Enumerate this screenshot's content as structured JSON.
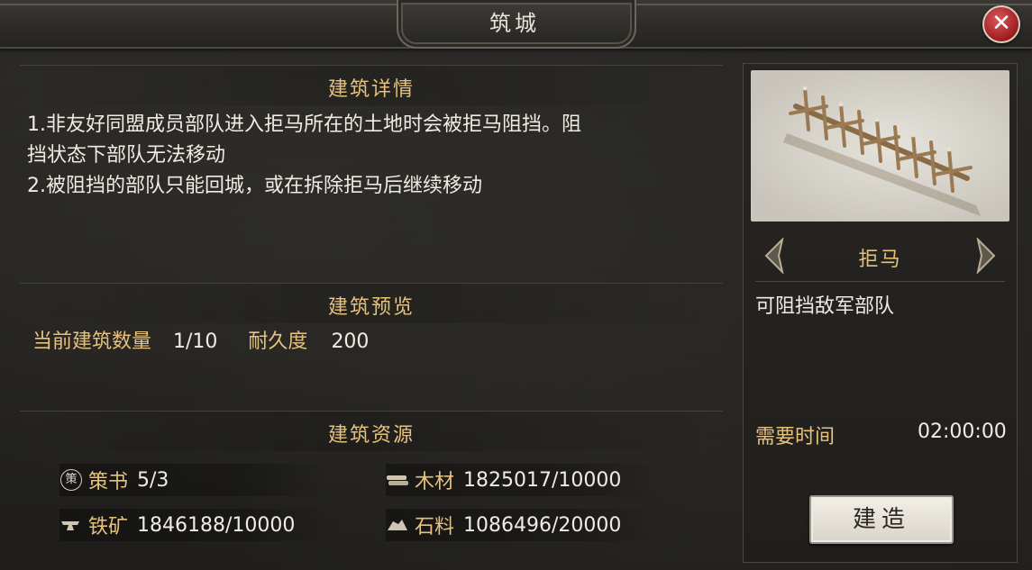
{
  "window": {
    "title": "筑城",
    "close_symbol": "✕"
  },
  "details": {
    "header": "建筑详情",
    "lines": [
      "1.非友好同盟成员部队进入拒马所在的土地时会被拒马阻挡。阻",
      "挡状态下部队无法移动",
      "2.被阻挡的部队只能回城，或在拆除拒马后继续移动"
    ]
  },
  "preview": {
    "header": "建筑预览",
    "count_label": "当前建筑数量",
    "count_value": "1/10",
    "durability_label": "耐久度",
    "durability_value": "200"
  },
  "resources": {
    "header": "建筑资源",
    "items": [
      {
        "icon": "book-icon",
        "icon_char": "策",
        "label": "策书",
        "value": "5/3"
      },
      {
        "icon": "wood-icon",
        "label": "木材",
        "value": "1825017/10000"
      },
      {
        "icon": "iron-icon",
        "label": "铁矿",
        "value": "1846188/10000"
      },
      {
        "icon": "stone-icon",
        "label": "石料",
        "value": "1086496/20000"
      }
    ]
  },
  "building": {
    "name": "拒马",
    "description": "可阻挡敌军部队",
    "time_label": "需要时间",
    "time_value": "02:00:00",
    "build_button": "建造"
  },
  "colors": {
    "accent_gold": "#e6c27c",
    "text_light": "#f0ece3",
    "close_red": "#b3262a"
  }
}
